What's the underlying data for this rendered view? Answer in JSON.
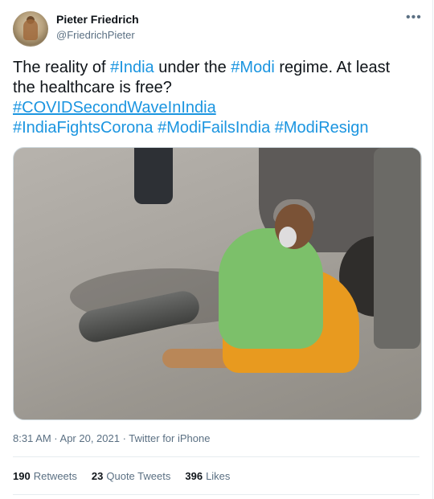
{
  "author": {
    "name": "Pieter Friedrich",
    "handle": "@FriedrichPieter"
  },
  "menu_glyph": "•••",
  "tweet": {
    "text_1": "The reality of ",
    "tag_india": "#India",
    "text_2": " under the ",
    "tag_modi": "#Modi",
    "text_3": " regime. At least the healthcare is free?",
    "tag_covid": "#COVIDSecondWaveInIndia",
    "tag_fights": "#IndiaFightsCorona",
    "tag_fails": "#ModiFailsIndia",
    "tag_resign": "#ModiResign"
  },
  "meta": "8:31 AM · Apr 20, 2021 · Twitter for iPhone",
  "stats": {
    "retweets_count": "190",
    "retweets_label": "Retweets",
    "quotes_count": "23",
    "quotes_label": "Quote Tweets",
    "likes_count": "396",
    "likes_label": "Likes"
  },
  "colors": {
    "hashtag": "#1b95e0",
    "secondary_text": "#5b7083",
    "primary_text": "#0f1419",
    "divider": "#e6ecf0"
  }
}
